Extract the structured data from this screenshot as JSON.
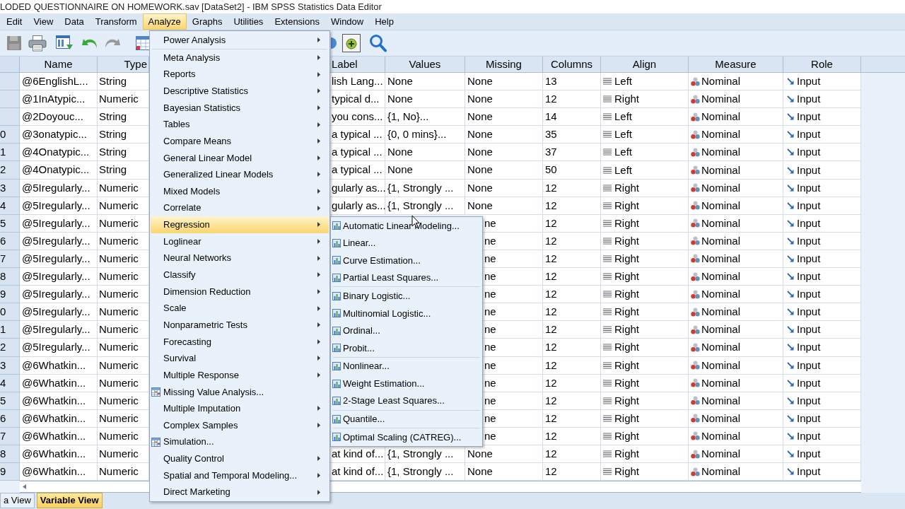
{
  "window": {
    "title": "LODED QUESTIONNAIRE ON HOMEWORK.sav [DataSet2] - IBM SPSS Statistics Data Editor"
  },
  "menu_bar": [
    {
      "label": "Edit",
      "selected": false
    },
    {
      "label": "View",
      "selected": false
    },
    {
      "label": "Data",
      "selected": false
    },
    {
      "label": "Transform",
      "selected": false
    },
    {
      "label": "Analyze",
      "selected": true
    },
    {
      "label": "Graphs",
      "selected": false
    },
    {
      "label": "Utilities",
      "selected": false
    },
    {
      "label": "Extensions",
      "selected": false
    },
    {
      "label": "Window",
      "selected": false
    },
    {
      "label": "Help",
      "selected": false
    }
  ],
  "table": {
    "columns": [
      "Name",
      "Type",
      "Label",
      "Values",
      "Missing",
      "Columns",
      "Align",
      "Measure",
      "Role"
    ],
    "rows": [
      {
        "name": "@6EnglishL...",
        "type": "String",
        "label": "lish Lang...",
        "values": "None",
        "missing": "None",
        "columns": "13",
        "align": "Left",
        "measure": "Nominal",
        "role": "Input"
      },
      {
        "name": "@1InAtypic...",
        "type": "Numeric",
        "label": "typical d...",
        "values": "None",
        "missing": "None",
        "columns": "12",
        "align": "Right",
        "measure": "Nominal",
        "role": "Input"
      },
      {
        "name": "@2Doyouc...",
        "type": "String",
        "label": "you cons...",
        "values": "{1, No}...",
        "missing": "None",
        "columns": "14",
        "align": "Left",
        "measure": "Nominal",
        "role": "Input"
      },
      {
        "row_number": "0",
        "name": "@3onatypic...",
        "type": "String",
        "label": "a typical ...",
        "values": "{0, 0 mins}...",
        "missing": "None",
        "columns": "35",
        "align": "Left",
        "measure": "Nominal",
        "role": "Input"
      },
      {
        "row_number": "1",
        "name": "@4Onatypic...",
        "type": "String",
        "label": "a typical ...",
        "values": "None",
        "missing": "None",
        "columns": "37",
        "align": "Left",
        "measure": "Nominal",
        "role": "Input"
      },
      {
        "row_number": "2",
        "name": "@4Onatypic...",
        "type": "String",
        "label": "a typical ...",
        "values": "None",
        "missing": "None",
        "columns": "50",
        "align": "Left",
        "measure": "Nominal",
        "role": "Input"
      },
      {
        "row_number": "3",
        "name": "@5Iregularly...",
        "type": "Numeric",
        "label": "gularly as...",
        "values": "{1, Strongly ...",
        "missing": "None",
        "columns": "12",
        "align": "Right",
        "measure": "Nominal",
        "role": "Input"
      },
      {
        "row_number": "4",
        "name": "@5Iregularly...",
        "type": "Numeric",
        "label": "gularly as...",
        "values": "{1, Strongly ...",
        "missing": "None",
        "columns": "12",
        "align": "Right",
        "measure": "Nominal",
        "role": "Input"
      },
      {
        "row_number": "5",
        "name": "@5Iregularly...",
        "type": "Numeric",
        "missing": "ne",
        "columns": "12",
        "align": "Right",
        "measure": "Nominal",
        "role": "Input"
      },
      {
        "row_number": "6",
        "name": "@5Iregularly...",
        "type": "Numeric",
        "missing": "ne",
        "columns": "12",
        "align": "Right",
        "measure": "Nominal",
        "role": "Input"
      },
      {
        "row_number": "7",
        "name": "@5Iregularly...",
        "type": "Numeric",
        "missing": "ne",
        "columns": "12",
        "align": "Right",
        "measure": "Nominal",
        "role": "Input"
      },
      {
        "row_number": "8",
        "name": "@5Iregularly...",
        "type": "Numeric",
        "missing": "ne",
        "columns": "12",
        "align": "Right",
        "measure": "Nominal",
        "role": "Input"
      },
      {
        "row_number": "9",
        "name": "@5Iregularly...",
        "type": "Numeric",
        "missing": "ne",
        "columns": "12",
        "align": "Right",
        "measure": "Nominal",
        "role": "Input"
      },
      {
        "row_number": "0",
        "name": "@5Iregularly...",
        "type": "Numeric",
        "missing": "ne",
        "columns": "12",
        "align": "Right",
        "measure": "Nominal",
        "role": "Input"
      },
      {
        "row_number": "1",
        "name": "@5Iregularly...",
        "type": "Numeric",
        "missing": "ne",
        "columns": "12",
        "align": "Right",
        "measure": "Nominal",
        "role": "Input"
      },
      {
        "row_number": "2",
        "name": "@5Iregularly...",
        "type": "Numeric",
        "missing": "ne",
        "columns": "12",
        "align": "Right",
        "measure": "Nominal",
        "role": "Input"
      },
      {
        "row_number": "3",
        "name": "@6Whatkin...",
        "type": "Numeric",
        "missing": "ne",
        "columns": "12",
        "align": "Right",
        "measure": "Nominal",
        "role": "Input"
      },
      {
        "row_number": "4",
        "name": "@6Whatkin...",
        "type": "Numeric",
        "missing": "ne",
        "columns": "12",
        "align": "Right",
        "measure": "Nominal",
        "role": "Input"
      },
      {
        "row_number": "5",
        "name": "@6Whatkin...",
        "type": "Numeric",
        "missing": "ne",
        "columns": "12",
        "align": "Right",
        "measure": "Nominal",
        "role": "Input"
      },
      {
        "row_number": "6",
        "name": "@6Whatkin...",
        "type": "Numeric",
        "missing": "ne",
        "columns": "12",
        "align": "Right",
        "measure": "Nominal",
        "role": "Input"
      },
      {
        "row_number": "7",
        "name": "@6Whatkin...",
        "type": "Numeric",
        "missing": "ne",
        "columns": "12",
        "align": "Right",
        "measure": "Nominal",
        "role": "Input"
      },
      {
        "row_number": "8",
        "name": "@6Whatkin...",
        "type": "Numeric",
        "label": "at kind of...",
        "values": "{1, Strongly ...",
        "missing": "None",
        "columns": "12",
        "align": "Right",
        "measure": "Nominal",
        "role": "Input"
      },
      {
        "row_number": "9",
        "name": "@6Whatkin...",
        "type": "Numeric",
        "label": "at kind of...",
        "values": "{1, Strongly ...",
        "missing": "None",
        "columns": "12",
        "align": "Right",
        "measure": "Nominal",
        "role": "Input"
      }
    ]
  },
  "view_tabs": [
    {
      "label": "a View",
      "selected": false
    },
    {
      "label": "Variable View",
      "selected": true
    }
  ],
  "analyze_menu": {
    "groups": [
      [
        {
          "label": "Power Analysis",
          "kind": "submenu",
          "selected": false
        }
      ],
      [
        {
          "label": "Meta Analysis",
          "kind": "submenu",
          "selected": false
        },
        {
          "label": "Reports",
          "kind": "submenu",
          "selected": false
        },
        {
          "label": "Descriptive Statistics",
          "kind": "submenu",
          "selected": false
        },
        {
          "label": "Bayesian Statistics",
          "kind": "submenu",
          "selected": false
        },
        {
          "label": "Tables",
          "kind": "submenu",
          "selected": false
        },
        {
          "label": "Compare Means",
          "kind": "submenu",
          "selected": false
        },
        {
          "label": "General Linear Model",
          "kind": "submenu",
          "selected": false
        },
        {
          "label": "Generalized Linear Models",
          "kind": "submenu",
          "selected": false
        },
        {
          "label": "Mixed Models",
          "kind": "submenu",
          "selected": false
        },
        {
          "label": "Correlate",
          "kind": "submenu",
          "selected": false
        },
        {
          "label": "Regression",
          "kind": "submenu",
          "selected": true
        },
        {
          "label": "Loglinear",
          "kind": "submenu",
          "selected": false
        },
        {
          "label": "Neural Networks",
          "kind": "submenu",
          "selected": false
        },
        {
          "label": "Classify",
          "kind": "submenu",
          "selected": false
        },
        {
          "label": "Dimension Reduction",
          "kind": "submenu",
          "selected": false
        },
        {
          "label": "Scale",
          "kind": "submenu",
          "selected": false
        },
        {
          "label": "Nonparametric Tests",
          "kind": "submenu",
          "selected": false
        },
        {
          "label": "Forecasting",
          "kind": "submenu",
          "selected": false
        },
        {
          "label": "Survival",
          "kind": "submenu",
          "selected": false
        },
        {
          "label": "Multiple Response",
          "kind": "submenu",
          "selected": false
        },
        {
          "label": "Missing Value Analysis...",
          "kind": "dialog",
          "selected": false
        },
        {
          "label": "Multiple Imputation",
          "kind": "submenu",
          "selected": false
        },
        {
          "label": "Complex Samples",
          "kind": "submenu",
          "selected": false
        },
        {
          "label": "Simulation...",
          "kind": "dialog",
          "selected": false
        },
        {
          "label": "Quality Control",
          "kind": "submenu",
          "selected": false
        },
        {
          "label": "Spatial and Temporal Modeling...",
          "kind": "submenu",
          "selected": false
        },
        {
          "label": "Direct Marketing",
          "kind": "submenu",
          "selected": false
        }
      ]
    ]
  },
  "regression_submenu": {
    "groups": [
      [
        {
          "label": "Automatic Linear Modeling...",
          "selected": false
        },
        {
          "label": "Linear...",
          "selected": false
        },
        {
          "label": "Curve Estimation...",
          "selected": false
        },
        {
          "label": "Partial Least Squares...",
          "selected": false
        }
      ],
      [
        {
          "label": "Binary Logistic...",
          "selected": false
        },
        {
          "label": "Multinomial Logistic...",
          "selected": false
        },
        {
          "label": "Ordinal...",
          "selected": false
        },
        {
          "label": "Probit...",
          "selected": false
        }
      ],
      [
        {
          "label": "Nonlinear...",
          "selected": false
        },
        {
          "label": "Weight Estimation...",
          "selected": false
        },
        {
          "label": "2-Stage Least Squares...",
          "selected": false
        }
      ],
      [
        {
          "label": "Quantile...",
          "selected": false
        }
      ],
      [
        {
          "label": "Optimal Scaling (CATREG)...",
          "selected": false
        }
      ]
    ]
  }
}
